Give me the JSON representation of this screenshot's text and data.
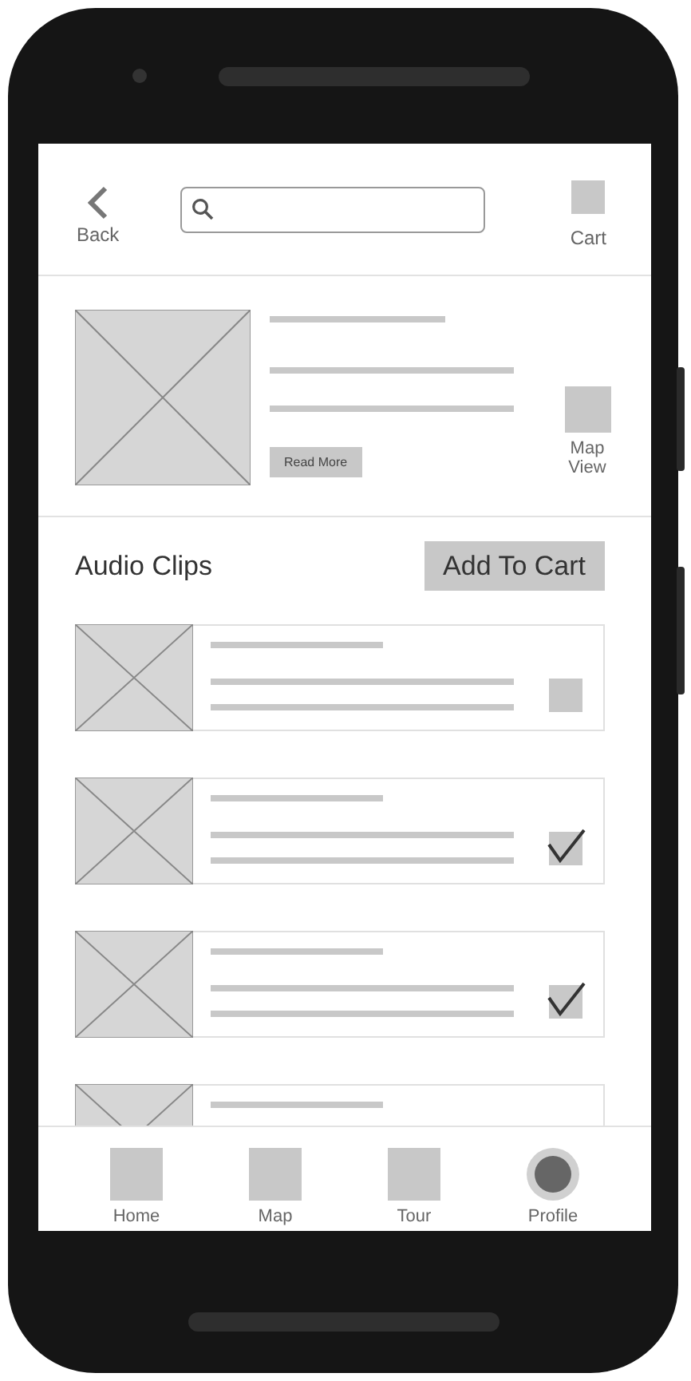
{
  "header": {
    "back": {
      "label": "Back"
    },
    "cart": {
      "label": "Cart"
    }
  },
  "featured": {
    "button": "Read More",
    "map_view": "Map View"
  },
  "section": {
    "title": "Audio Clips",
    "button": "Add To Cart"
  },
  "clips": [
    {
      "kind": "row",
      "checked": false
    },
    {
      "kind": "row",
      "checked": true
    },
    {
      "kind": "row",
      "checked": true
    },
    {
      "kind": "cut_off"
    }
  ],
  "nav": [
    {
      "label": "Home",
      "kind": "square"
    },
    {
      "label": "Map",
      "kind": "square"
    },
    {
      "label": "Tour",
      "kind": "square"
    },
    {
      "label": "Profile",
      "kind": "circle"
    }
  ]
}
